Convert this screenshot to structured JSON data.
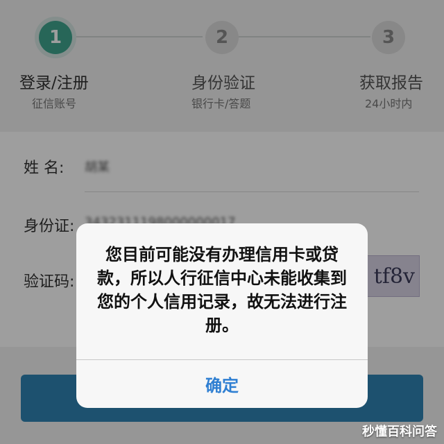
{
  "stepper": {
    "steps": [
      {
        "number": "1",
        "title": "登录/注册",
        "subtitle": "征信账号",
        "state": "active"
      },
      {
        "number": "2",
        "title": "身份验证",
        "subtitle": "银行卡/答题",
        "state": "inactive"
      },
      {
        "number": "3",
        "title": "获取报告",
        "subtitle": "24小时内",
        "state": "inactive"
      }
    ]
  },
  "form": {
    "name_label": "姓 名:",
    "name_value": "胡某",
    "id_label": "身份证:",
    "id_value": "3432311198000000017",
    "captcha_label": "验证码:",
    "captcha_text": "tf8v"
  },
  "alert": {
    "message": "您目前可能没有办理信用卡或贷款，所以人行征信中心未能收集到您的个人信用记录，故无法进行注册。",
    "confirm_label": "确定"
  },
  "watermark": {
    "text": "秒懂百科问答"
  },
  "colors": {
    "accent": "#3fa58f",
    "button": "#2f84b3",
    "link": "#2f7fd2"
  }
}
